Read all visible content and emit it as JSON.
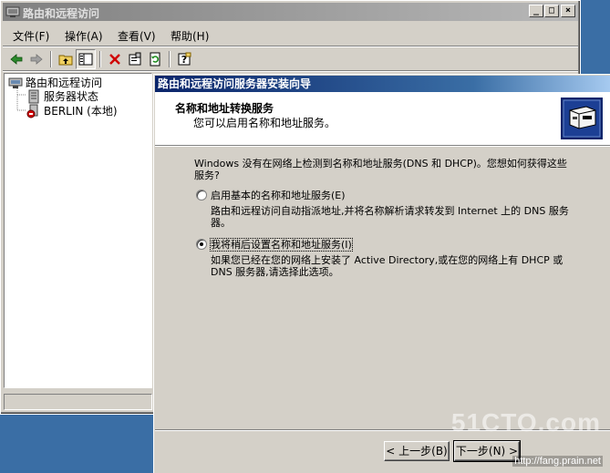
{
  "window": {
    "title": "路由和远程访问",
    "controls": [
      "_",
      "□",
      "×"
    ]
  },
  "menu": [
    {
      "label": "文件(F)"
    },
    {
      "label": "操作(A)"
    },
    {
      "label": "查看(V)"
    },
    {
      "label": "帮助(H)"
    }
  ],
  "toolbar": {
    "icons": [
      "back-arrow-icon",
      "forward-arrow-icon",
      "up-folder-icon",
      "show-tree-icon",
      "delete-icon",
      "properties-icon",
      "refresh-icon",
      "help-icon"
    ]
  },
  "tree": {
    "root": "路由和远程访问",
    "server_status": "服务器状态",
    "server": "BERLIN (本地)"
  },
  "wizard": {
    "title": "路由和远程访问服务器安装向导",
    "heading": "名称和地址转换服务",
    "subheading": "您可以启用名称和地址服务。",
    "intro": "Windows 没有在网络上检测到名称和地址服务(DNS 和 DHCP)。您想如何获得这些服务?",
    "option1": {
      "label": "启用基本的名称和地址服务(E)",
      "desc": "路由和远程访问自动指派地址,并将名称解析请求转发到 Internet 上的 DNS 服务器。",
      "checked": false
    },
    "option2": {
      "label": "我将稍后设置名称和地址服务(I)",
      "desc": "如果您已经在您的网络上安装了 Active Directory,或在您的网络上有 DHCP 或 DNS 服务器,请选择此选项。",
      "checked": true
    },
    "buttons": {
      "back": "< 上一步(B)",
      "next": "下一步(N) >"
    }
  },
  "watermark": {
    "brand": "51CTO.com",
    "url": "http://fang.prain.net"
  },
  "colors": {
    "desktop": "#3a6ea5",
    "active_title_start": "#0a246a",
    "active_title_end": "#a6caf0",
    "face": "#d4d0c8"
  }
}
